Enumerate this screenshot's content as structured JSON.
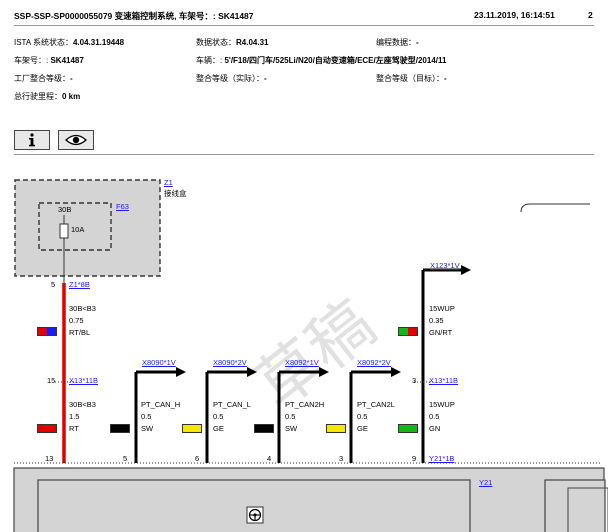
{
  "header": {
    "title": "SSP-SSP-SP0000055079 变速箱控制系统, 车架号：: SK41487",
    "datetime": "23.11.2019, 16:14:51",
    "page": "2"
  },
  "info": {
    "ista_label": "ISTA 系统状态：",
    "ista_value": "4.04.31.19448",
    "data_label": "数据状态：",
    "data_value": "R4.04.31",
    "prog_label": "编程数据：",
    "prog_value": "-",
    "vin_label": "车架号：:",
    "vin_value": "SK41487",
    "vehicle_label": "车辆：:",
    "vehicle_value": "5'/F18/四门车/525Li/N20/自动变速箱/ECE/左座驾驶型/2014/11",
    "factory_label": "工厂整合等级：",
    "factory_value": "-",
    "integ_actual_label": "整合等级（实际）：",
    "integ_actual_value": "-",
    "integ_target_label": "整合等级（目标）：",
    "integ_target_value": "-",
    "mileage_label": "总行驶里程：",
    "mileage_value": "0 km"
  },
  "toolbar": {
    "info_icon": "info-icon",
    "eye_icon": "eye-icon"
  },
  "diagram": {
    "z1_label": "Z1",
    "z1_desc": "接线盒",
    "f63_label": "F63",
    "fuse_top": "30B",
    "fuse_rating": "10A",
    "pin5": "5",
    "z1_pin": "Z1*8B",
    "red_wire_term": "30B<B3",
    "red_wire_size": "0.75",
    "red_wire_color": "RT/BL",
    "pin15": "15",
    "x13_11b": "X13*11B",
    "red2_term": "30B<B3",
    "red2_size": "1.5",
    "red2_color": "RT",
    "pin13": "13",
    "x123": "X123*1V",
    "r_wire_term": "15WUP",
    "r_wire_size": "0.35",
    "r_wire_color": "GN/RT",
    "pin3": "3",
    "x13_11b_b": "X13*11B",
    "r2_term": "15WUP",
    "r2_size": "0.5",
    "r2_color": "GN",
    "pin9": "9",
    "y21_1b": "Y21*1B",
    "y21": "Y21",
    "conns": [
      {
        "link": "X8090*1V",
        "name": "PT_CAN_H",
        "size": "0.5",
        "color": "SW",
        "pin": "5"
      },
      {
        "link": "X8090*2V",
        "name": "PT_CAN_L",
        "size": "0.5",
        "color": "GE",
        "pin": "6"
      },
      {
        "link": "X8092*1V",
        "name": "PT_CAN2H",
        "size": "0.5",
        "color": "SW",
        "pin": "4"
      },
      {
        "link": "X8092*2V",
        "name": "PT_CAN2L",
        "size": "0.5",
        "color": "GE",
        "pin": "3"
      }
    ],
    "watermark": "草稿",
    "colors": {
      "red": "#e00000",
      "black": "#000000",
      "yellow": "#f5e600",
      "green": "#18b418",
      "blue": "#1a1aff",
      "box_gray": "#d4d4d4"
    }
  }
}
